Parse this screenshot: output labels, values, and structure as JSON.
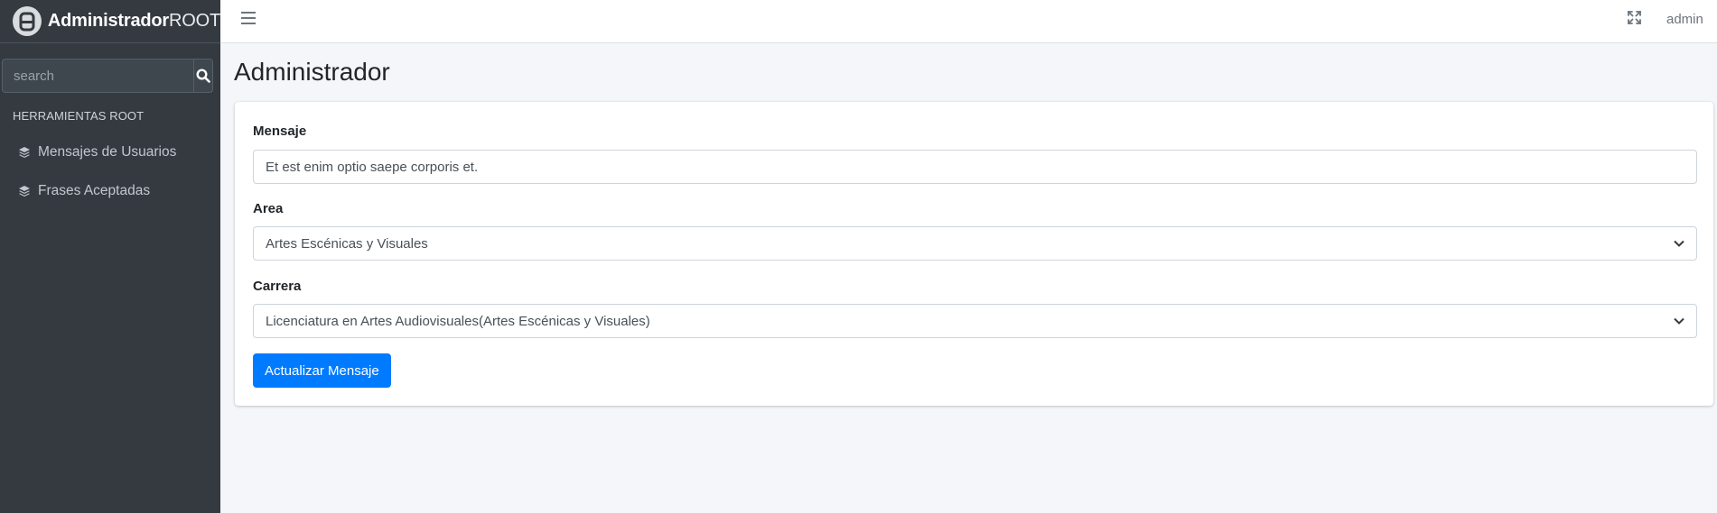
{
  "brand": {
    "name_bold": "Administrador",
    "name_light": "ROOT",
    "logo_icon": "app-logo-icon"
  },
  "sidebar": {
    "search": {
      "placeholder": "search",
      "value": ""
    },
    "search_icon": "search-icon",
    "section_header": "HERRAMIENTAS ROOT",
    "items": [
      {
        "label": "Mensajes de Usuarios",
        "icon": "layers-icon"
      },
      {
        "label": "Frases Aceptadas",
        "icon": "layers-icon"
      }
    ]
  },
  "navbar": {
    "menu_icon": "hamburger-menu-icon",
    "fullscreen_icon": "expand-icon",
    "user": "admin"
  },
  "page": {
    "title": "Administrador"
  },
  "form": {
    "mensaje_label": "Mensaje",
    "mensaje_value": "Et est enim optio saepe corporis et.",
    "area_label": "Area",
    "area_value": "Artes Escénicas y Visuales",
    "carrera_label": "Carrera",
    "carrera_value": "Licenciatura en Artes Audiovisuales(Artes Escénicas y Visuales)",
    "submit_label": "Actualizar Mensaje"
  },
  "colors": {
    "sidebar_bg": "#343a40",
    "primary": "#007bff",
    "content_bg": "#f4f6f9"
  }
}
